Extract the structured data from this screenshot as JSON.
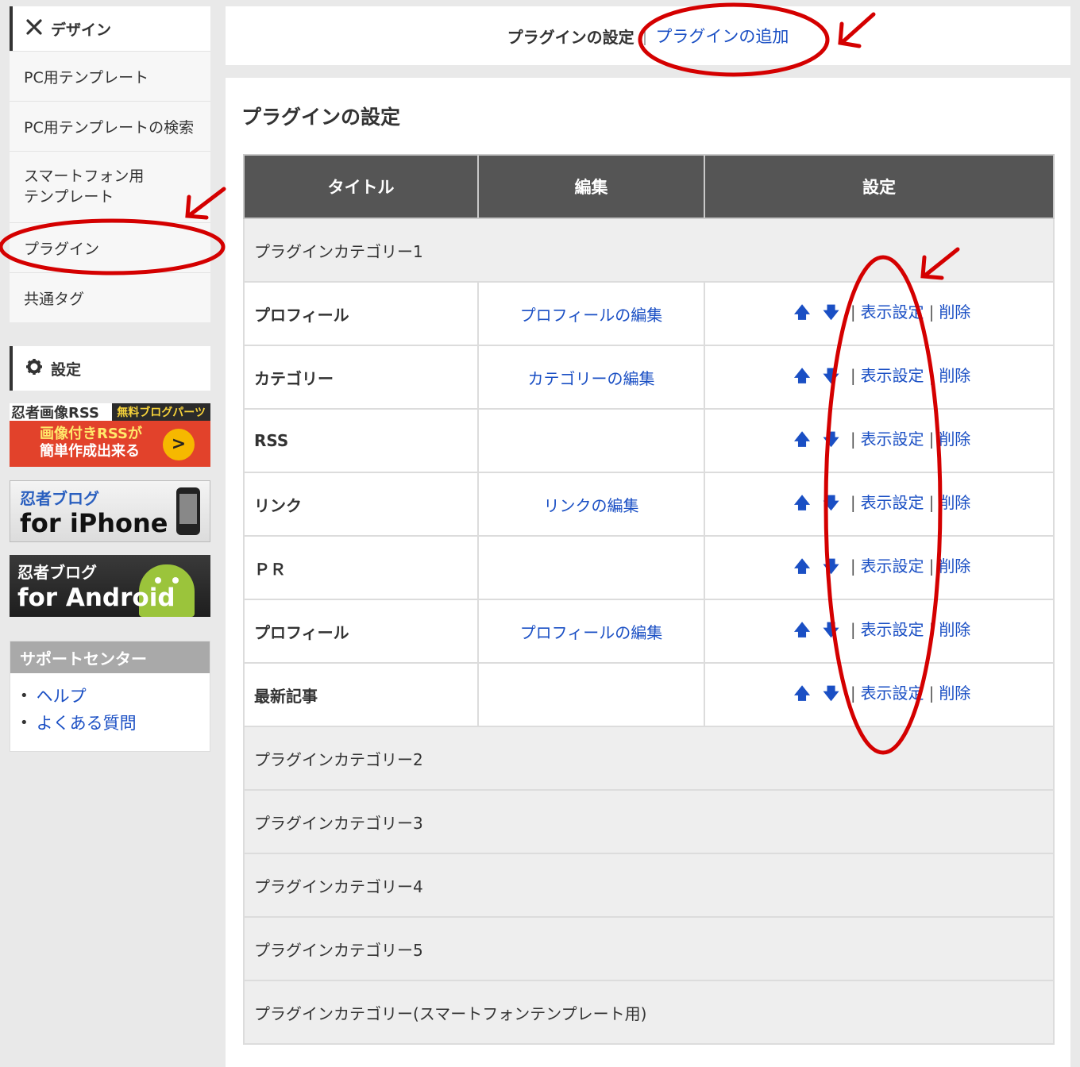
{
  "sidebar": {
    "design_head": "デザイン",
    "items": [
      {
        "label": "PC用テンプレート"
      },
      {
        "label": "PC用テンプレートの検索"
      },
      {
        "label": "スマートフォン用\nテンプレート"
      },
      {
        "label": "プラグイン"
      },
      {
        "label": "共通タグ"
      }
    ],
    "settings_head": "設定"
  },
  "banners": {
    "rss": {
      "brand": "忍者画像RSS",
      "badge": "無料ブログパーツ",
      "line1": "画像付きRSSが",
      "line2": "簡単作成出来る"
    },
    "iphone": {
      "brand": "忍者ブログ",
      "text": "for iPhone"
    },
    "android": {
      "brand": "忍者ブログ",
      "text": "for Android"
    }
  },
  "support": {
    "head": "サポートセンター",
    "links": [
      "ヘルプ",
      "よくある質問"
    ]
  },
  "topbar": {
    "current": "プラグインの設定",
    "add_link": "プラグインの追加"
  },
  "panel": {
    "title": "プラグインの設定",
    "columns": [
      "タイトル",
      "編集",
      "設定"
    ],
    "rows": [
      {
        "type": "category",
        "label": "プラグインカテゴリー1"
      },
      {
        "type": "item",
        "title": "プロフィール",
        "edit": "プロフィールの編集"
      },
      {
        "type": "item",
        "title": "カテゴリー",
        "edit": "カテゴリーの編集"
      },
      {
        "type": "item",
        "title": "RSS",
        "edit": ""
      },
      {
        "type": "item",
        "title": "リンク",
        "edit": "リンクの編集"
      },
      {
        "type": "item",
        "title": "ＰＲ",
        "edit": ""
      },
      {
        "type": "item",
        "title": "プロフィール",
        "edit": "プロフィールの編集"
      },
      {
        "type": "item",
        "title": "最新記事",
        "edit": ""
      },
      {
        "type": "category",
        "label": "プラグインカテゴリー2"
      },
      {
        "type": "category",
        "label": "プラグインカテゴリー3"
      },
      {
        "type": "category",
        "label": "プラグインカテゴリー4"
      },
      {
        "type": "category",
        "label": "プラグインカテゴリー5"
      },
      {
        "type": "category",
        "label": "プラグインカテゴリー(スマートフォンテンプレート用)"
      }
    ],
    "actions": {
      "up": "🡅",
      "down": "🡇",
      "display": "表示設定",
      "delete": "削除",
      "separator": "|"
    }
  },
  "colors": {
    "link": "#1a4fc4",
    "header_bg": "#555555",
    "annotation": "#d40000"
  }
}
